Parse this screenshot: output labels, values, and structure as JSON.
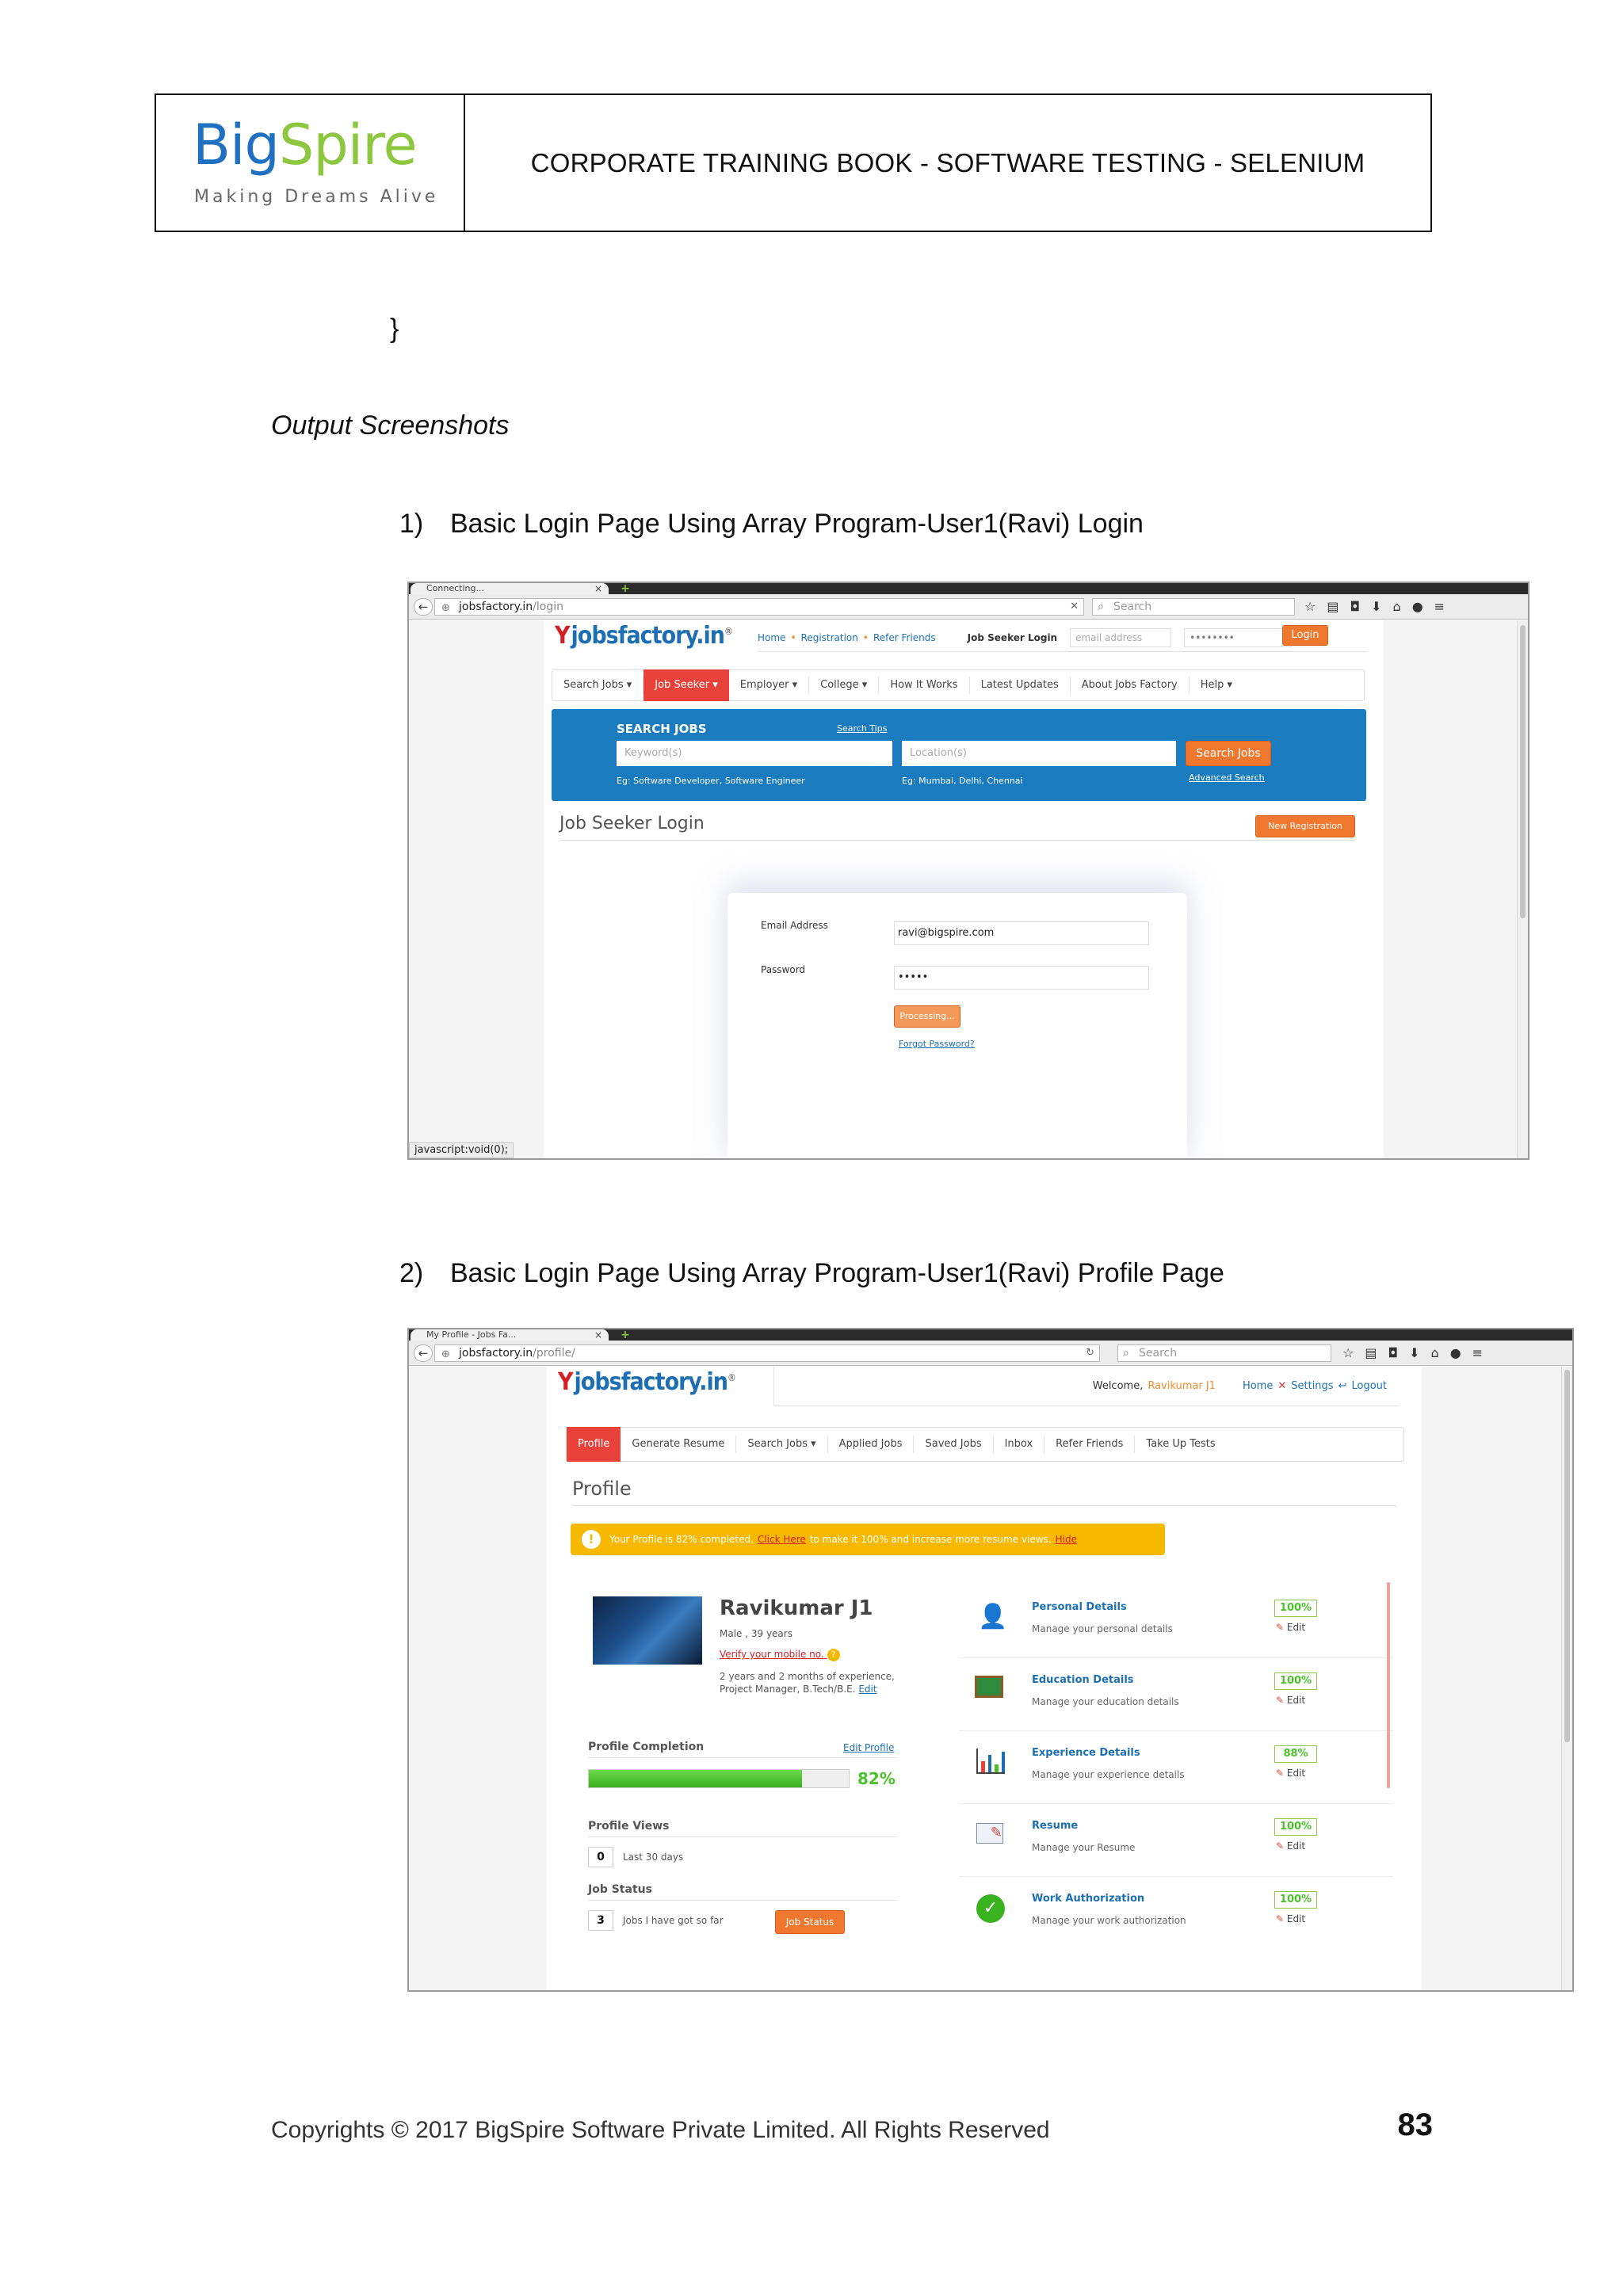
{
  "header": {
    "logo_big": "Big",
    "logo_spire": "Spire",
    "logo_tagline": "Making Dreams Alive",
    "title": "CORPORATE TRAINING BOOK - SOFTWARE TESTING - SELENIUM"
  },
  "closing_brace": "}",
  "section_title": "Output Screenshots",
  "items": [
    {
      "num": "1)",
      "text": "Basic Login Page Using Array Program-User1(Ravi) Login"
    },
    {
      "num": "2)",
      "text": "Basic Login Page Using Array Program-User1(Ravi) Profile Page"
    }
  ],
  "shot1": {
    "tab_title": "Connecting...",
    "url_host": "jobsfactory.in",
    "url_path": "/login",
    "search_placeholder": "Search",
    "logo_text": "jobsfactory.in",
    "top_links": [
      "Home",
      "Registration",
      "Refer Friends"
    ],
    "login_label": "Job Seeker Login",
    "email_placeholder": "email address",
    "password_mask": "••••••••",
    "login_button": "Login",
    "nav": [
      "Search Jobs ▾",
      "Job Seeker ▾",
      "Employer ▾",
      "College ▾",
      "How It Works",
      "Latest Updates",
      "About Jobs Factory",
      "Help ▾"
    ],
    "search_title": "SEARCH JOBS",
    "search_tips": "Search Tips",
    "keyword_placeholder": "Keyword(s)",
    "location_placeholder": "Location(s)",
    "search_button": "Search Jobs",
    "keyword_hint": "Eg: Software Developer, Software Engineer",
    "location_hint": "Eg: Mumbai, Delhi, Chennai",
    "advanced_search": "Advanced Search",
    "page_heading": "Job Seeker Login",
    "new_registration": "New Registration",
    "email_label": "Email Address",
    "email_value": "ravi@bigspire.com",
    "password_label": "Password",
    "password_value": "•••••",
    "processing_button": "Processing...",
    "forgot_password": "Forgot Password?",
    "status_bar": "javascript:void(0);"
  },
  "shot2": {
    "tab_title": "My Profile - Jobs Fa...",
    "url_host": "jobsfactory.in",
    "url_path": "/profile/",
    "search_placeholder": "Search",
    "logo_text": "jobsfactory.in",
    "welcome": "Welcome,",
    "user_name": "Ravikumar J1",
    "header_links": [
      "Home",
      "Settings",
      "Logout"
    ],
    "nav": [
      "Profile",
      "Generate Resume",
      "Search Jobs ▾",
      "Applied Jobs",
      "Saved Jobs",
      "Inbox",
      "Refer Friends",
      "Take Up Tests"
    ],
    "page_heading": "Profile",
    "banner_text": "Your Profile is 82% completed.",
    "banner_link": "Click Here",
    "banner_rest": "to make it 100% and increase more resume views.",
    "banner_hide": "Hide",
    "profile_name": "Ravikumar J1",
    "profile_meta": "Male , 39 years",
    "verify_mobile": "Verify your mobile no.",
    "experience_line1": "2 years and 2 months of experience,",
    "experience_line2": "Project Manager, B.Tech/B.E.",
    "edit_link": "Edit",
    "completion_label": "Profile Completion",
    "edit_profile": "Edit Profile",
    "completion_percent": "82%",
    "completion_value": 0.82,
    "views_label": "Profile Views",
    "views_count": "0",
    "views_period": "Last 30 days",
    "status_label": "Job Status",
    "status_count": "3",
    "status_desc": "Jobs I have got so far",
    "status_button": "Job Status",
    "sections": [
      {
        "title": "Personal Details",
        "desc": "Manage your personal details",
        "percent": "100%",
        "edit": "Edit",
        "icon": "person-icon"
      },
      {
        "title": "Education Details",
        "desc": "Manage your education details",
        "percent": "100%",
        "edit": "Edit",
        "icon": "blackboard-icon"
      },
      {
        "title": "Experience Details",
        "desc": "Manage your experience details",
        "percent": "88%",
        "edit": "Edit",
        "icon": "bar-chart-icon"
      },
      {
        "title": "Resume",
        "desc": "Manage your Resume",
        "percent": "100%",
        "edit": "Edit",
        "icon": "resume-icon"
      },
      {
        "title": "Work Authorization",
        "desc": "Manage your work authorization",
        "percent": "100%",
        "edit": "Edit",
        "icon": "checkmark-icon"
      }
    ]
  },
  "footer": "Copyrights © 2017 BigSpire Software Private Limited. All Rights Reserved",
  "page_number": "83",
  "colors": {
    "brand_blue": "#1f70c1",
    "brand_green": "#8dc63f",
    "jf_red": "#e8423b",
    "jf_orange": "#f0782e",
    "jf_search_blue": "#1a7bbf",
    "progress_green": "#4cc22a",
    "banner_yellow": "#f7b800"
  }
}
